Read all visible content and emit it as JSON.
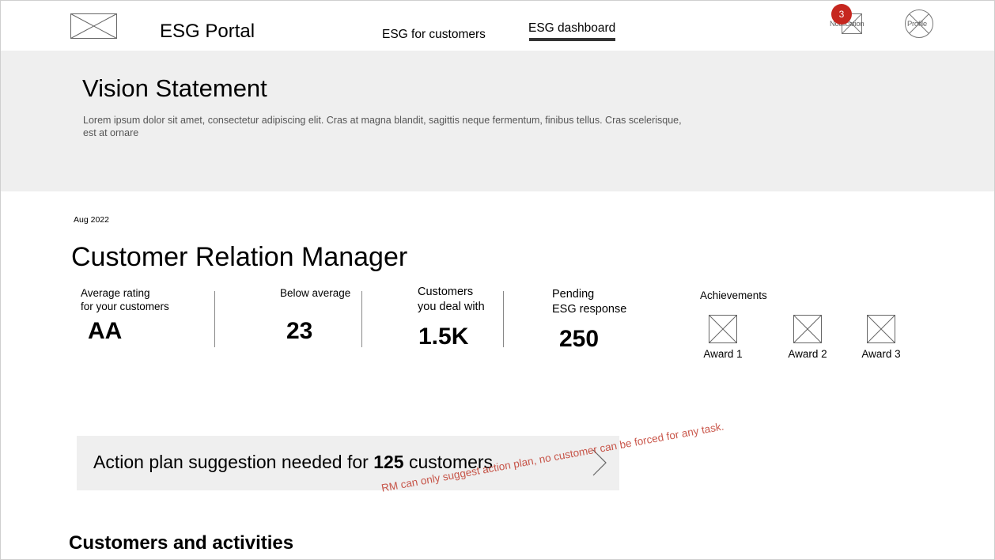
{
  "header": {
    "logo_icon": "image-placeholder-icon",
    "app_title": "ESG Portal",
    "nav": [
      {
        "label": "ESG for customers",
        "active": false
      },
      {
        "label": "ESG dashboard",
        "active": true
      }
    ],
    "notification": {
      "label": "Notification",
      "count": "3",
      "badge_color": "#c6271f",
      "icon": "bell-placeholder-icon"
    },
    "profile": {
      "label": "Profile",
      "icon": "avatar-placeholder-icon"
    }
  },
  "vision": {
    "title": "Vision Statement",
    "body": "Lorem ipsum dolor sit amet, consectetur adipiscing elit. Cras at magna blandit, sagittis neque fermentum, finibus tellus. Cras scelerisque, est at ornare"
  },
  "manager": {
    "date": "Aug 2022",
    "title": "Customer Relation Manager",
    "kpis": [
      {
        "label_line1": "Average rating",
        "label_line2": "for your customers",
        "value": "AA"
      },
      {
        "label_line1": "Below average",
        "label_line2": "",
        "value": "23"
      },
      {
        "label_line1": "Customers",
        "label_line2": "you deal with",
        "value": "1.5K"
      },
      {
        "label_line1": "Pending",
        "label_line2": "ESG response",
        "value": "250"
      }
    ],
    "achievements": {
      "label": "Achievements",
      "awards": [
        "Award 1",
        "Award 2",
        "Award 3"
      ]
    }
  },
  "action_plan": {
    "prefix": "Action plan suggestion needed for ",
    "count": "125",
    "suffix": " customers",
    "chevron_icon": "chevron-right-icon"
  },
  "annotation": "RM can only suggest action plan, no customer can be forced for any task.",
  "customers_section": {
    "title": "Customers and activities"
  },
  "colors": {
    "band_bg": "#efefef",
    "accent_red": "#c6271f",
    "annotation_red": "#c0392b"
  }
}
